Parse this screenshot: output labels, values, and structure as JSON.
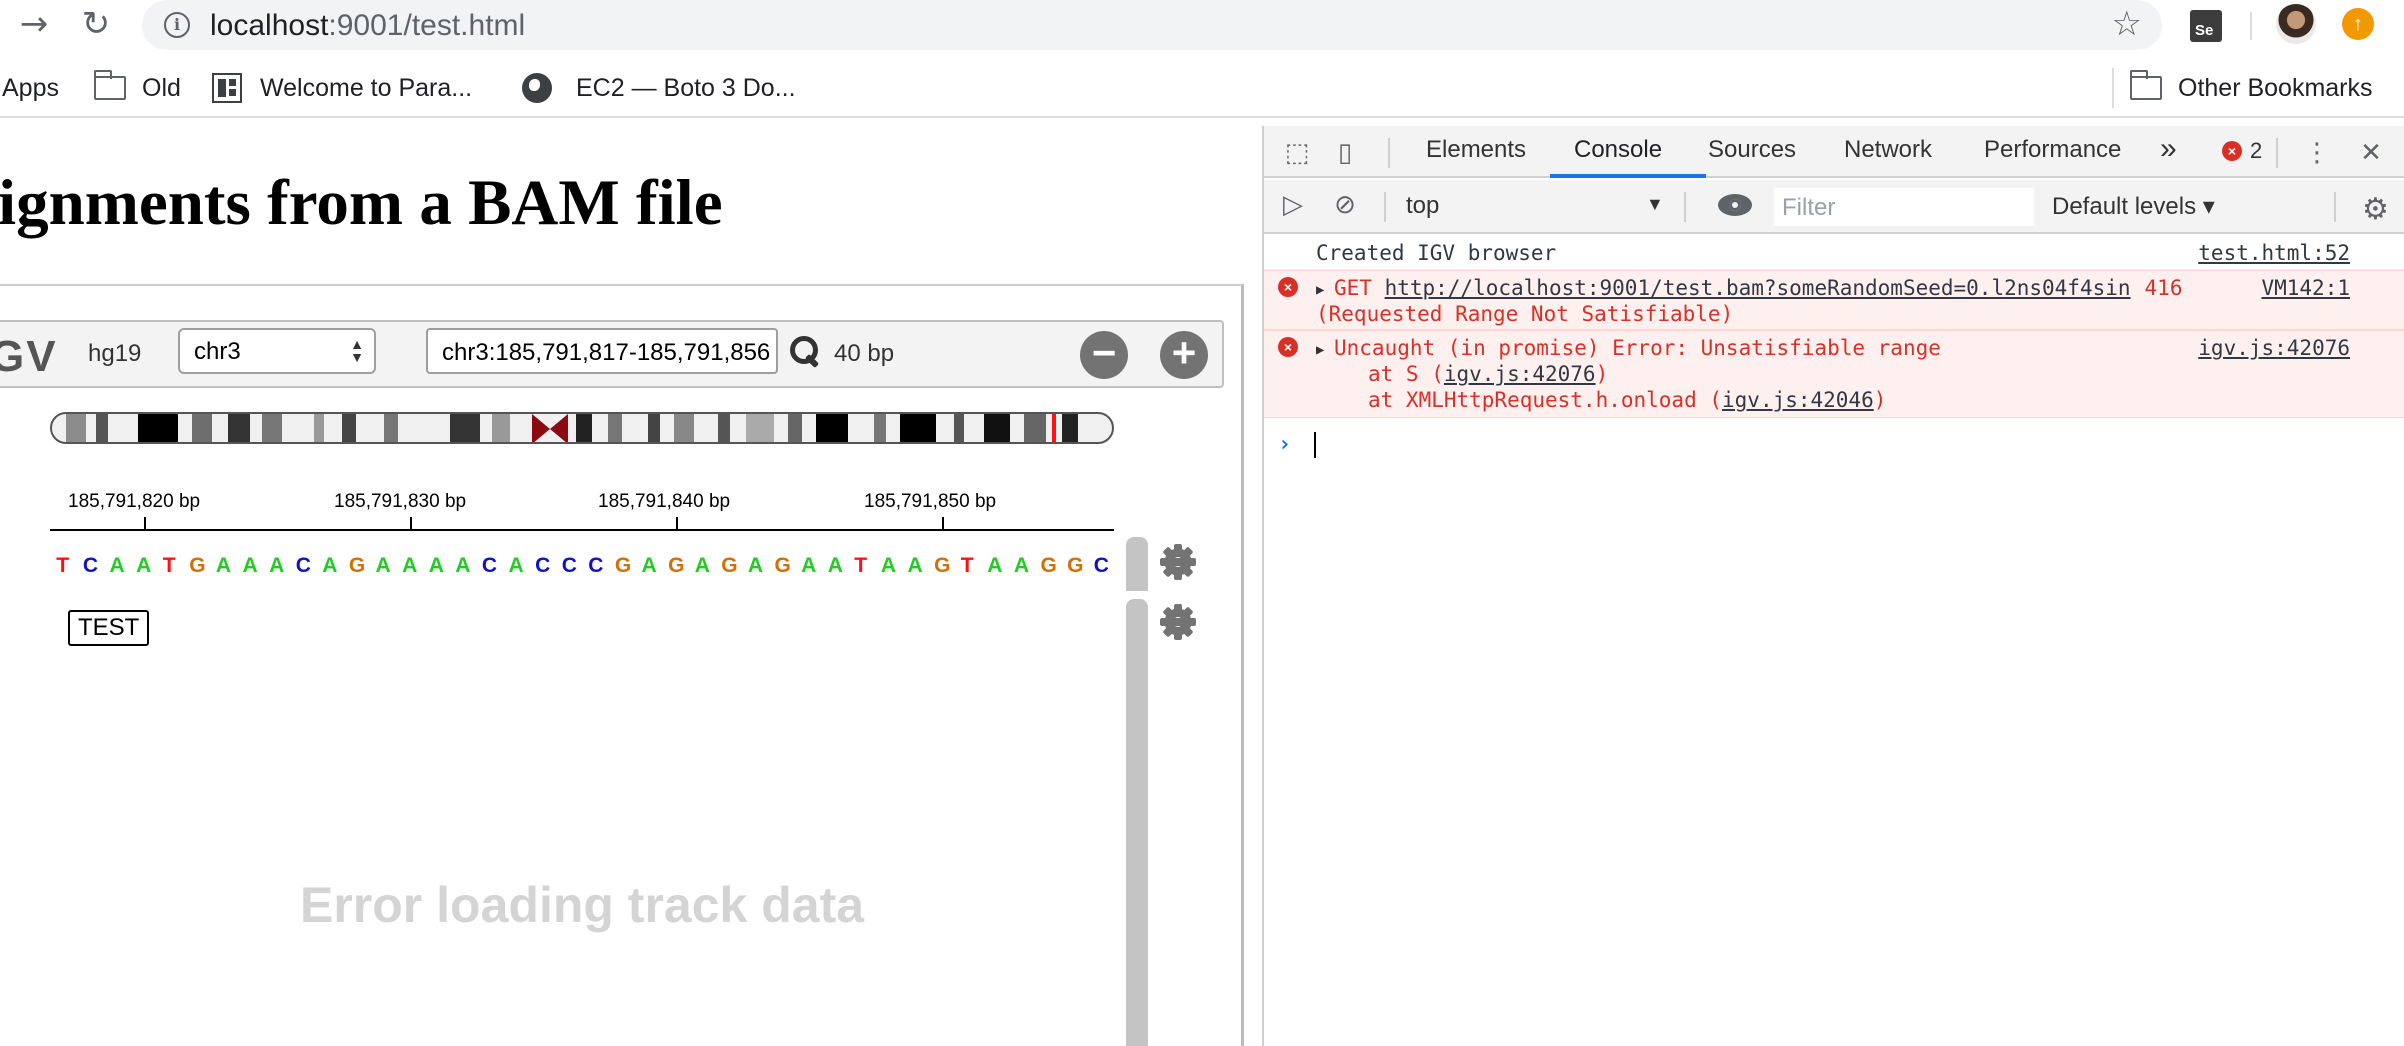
{
  "browser": {
    "url_host": "localhost",
    "url_rest": ":9001/test.html",
    "info_icon": "i",
    "extension_se": "Se",
    "bookmarks": [
      {
        "label": "Apps",
        "icon": "apps-grid-icon"
      },
      {
        "label": "Old",
        "icon": "folder-icon"
      },
      {
        "label": "Welcome to Para...",
        "icon": "paraview-icon"
      },
      {
        "label": "EC2 — Boto 3 Do...",
        "icon": "globe-icon"
      }
    ],
    "other_bookmarks": "Other Bookmarks"
  },
  "page": {
    "title": "lignments from a BAM file",
    "igv": {
      "logo": "GV",
      "genome": "hg19",
      "chromosome": "chr3",
      "locus": "chr3:185,791,817-185,791,856",
      "window_size": "40 bp",
      "zoom_out": "−",
      "zoom_in": "+",
      "ruler_ticks": [
        "185,791,820 bp",
        "185,791,830 bp",
        "185,791,840 bp",
        "185,791,850 bp"
      ],
      "sequence": [
        "T",
        "C",
        "A",
        "A",
        "T",
        "G",
        "A",
        "A",
        "A",
        "C",
        "A",
        "G",
        "A",
        "A",
        "A",
        "A",
        "C",
        "A",
        "C",
        "C",
        "C",
        "G",
        "A",
        "G",
        "A",
        "G",
        "A",
        "G",
        "A",
        "A",
        "T",
        "A",
        "A",
        "G",
        "T",
        "A",
        "A",
        "G",
        "G",
        "C"
      ],
      "base_colors": {
        "A": "#22cc22",
        "C": "#1111cc",
        "G": "#d17105",
        "T": "#ff1111"
      },
      "track_name": "TEST",
      "error_message": "Error loading track data"
    }
  },
  "devtools": {
    "tabs": [
      "Elements",
      "Console",
      "Sources",
      "Network",
      "Performance"
    ],
    "active_tab": "Console",
    "more_tabs": "»",
    "error_count": "2",
    "context": "top",
    "filter_placeholder": "Filter",
    "levels": "Default levels ▾",
    "messages": [
      {
        "type": "log",
        "text": "Created IGV browser",
        "source": "test.html:52"
      },
      {
        "type": "error",
        "prefix": "GET ",
        "url": "http://localhost:9001/test.bam?someRandomSeed=0.l2ns04f4sin",
        "status": "416",
        "source": "VM142:1",
        "line2": "(Requested Range Not Satisfiable)"
      },
      {
        "type": "error",
        "text": "Uncaught (in promise) Error: Unsatisfiable range",
        "source": "igv.js:42076",
        "stack1_pre": "at S (",
        "stack1_link": "igv.js:42076",
        "stack1_post": ")",
        "stack2_pre": "at XMLHttpRequest.h.onload (",
        "stack2_link": "igv.js:42046",
        "stack2_post": ")"
      }
    ]
  }
}
